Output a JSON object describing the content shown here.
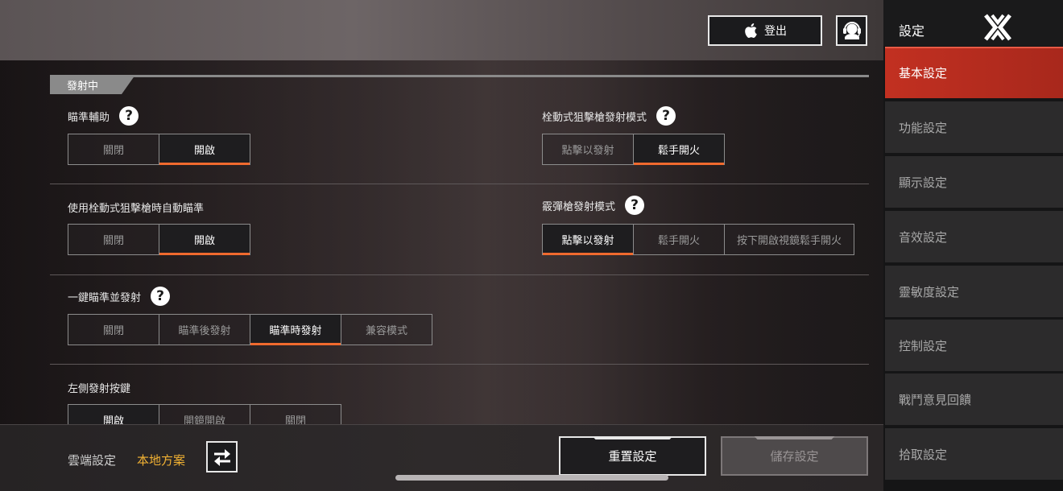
{
  "topbar": {
    "logout_label": "登出"
  },
  "section": {
    "title": "發射中"
  },
  "settings": {
    "aim_assist": {
      "label": "瞄準輔助",
      "options": [
        "關閉",
        "開啟"
      ],
      "selected": 1
    },
    "bolt_sniper_fire_mode": {
      "label": "栓動式狙擊槍發射模式",
      "options": [
        "點擊以發射",
        "鬆手開火"
      ],
      "selected": 1
    },
    "bolt_sniper_auto_aim": {
      "label": "使用栓動式狙擊槍時自動瞄準",
      "options": [
        "關閉",
        "開啟"
      ],
      "selected": 1
    },
    "shotgun_fire_mode": {
      "label": "霰彈槍發射模式",
      "options": [
        "點擊以發射",
        "鬆手開火",
        "按下開啟視鏡鬆手開火"
      ],
      "selected": 0
    },
    "one_tap_aim_fire": {
      "label": "一鍵瞄準並發射",
      "options": [
        "關閉",
        "瞄準後發射",
        "瞄準時發射",
        "兼容模式"
      ],
      "selected": 2
    },
    "left_fire_button": {
      "label": "左側發射按鍵",
      "options": [
        "開啟",
        "開鏡開啟",
        "關閉"
      ],
      "selected": 0
    }
  },
  "bottom": {
    "cloud_label": "雲端設定",
    "local_label": "本地方案",
    "reset_label": "重置設定",
    "save_label": "儲存設定"
  },
  "sidebar": {
    "title": "設定",
    "items": [
      {
        "label": "基本設定",
        "active": true
      },
      {
        "label": "功能設定",
        "active": false
      },
      {
        "label": "顯示設定",
        "active": false
      },
      {
        "label": "音效設定",
        "active": false
      },
      {
        "label": "靈敏度設定",
        "active": false
      },
      {
        "label": "控制設定",
        "active": false
      },
      {
        "label": "戰鬥意見回饋",
        "active": false
      },
      {
        "label": "拾取設定",
        "active": false
      }
    ]
  },
  "colors": {
    "accent": "#f06a2e",
    "active_nav": "#c23021",
    "local_text": "#f2b233"
  }
}
